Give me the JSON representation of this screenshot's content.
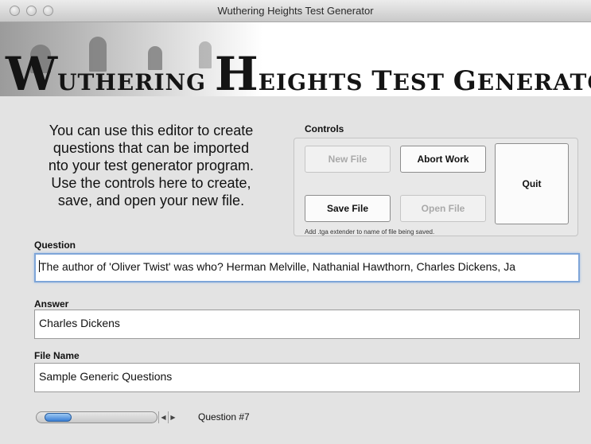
{
  "window": {
    "title": "Wuthering Heights Test Generator"
  },
  "banner": {
    "title_parts": [
      "W",
      "UTHERING ",
      "H",
      "EIGHTS ",
      "T",
      "EST ",
      "G",
      "ENERATOR"
    ]
  },
  "intro": {
    "lines": [
      "You can use this editor to create",
      "questions that can be imported",
      "nto your test generator program.",
      "Use the controls here to create,",
      "save, and open your new file."
    ]
  },
  "controls": {
    "label": "Controls",
    "new_file": "New File",
    "abort_work": "Abort Work",
    "quit": "Quit",
    "save_file": "Save File",
    "open_file": "Open File",
    "hint": "Add .tga extender to name of file being saved."
  },
  "question": {
    "label": "Question",
    "value": "The author of 'Oliver Twist' was who? Herman Melville, Nathanial Hawthorn, Charles Dickens, Ja"
  },
  "answer": {
    "label": "Answer",
    "value": "Charles Dickens"
  },
  "file_name": {
    "label": "File Name",
    "value": "Sample Generic Questions"
  },
  "navigator": {
    "left_arrow": "◀",
    "right_arrow": "▶",
    "position_fraction": 0.05,
    "question_label": "Question #7"
  },
  "icons": {
    "traffic_lights": [
      "close-icon",
      "minimize-icon",
      "zoom-icon"
    ],
    "stepper": [
      "arrow-left-icon",
      "arrow-right-icon"
    ]
  },
  "colors": {
    "focus_ring": "#7ea5d8",
    "slider_thumb": "#3a7fd4"
  }
}
